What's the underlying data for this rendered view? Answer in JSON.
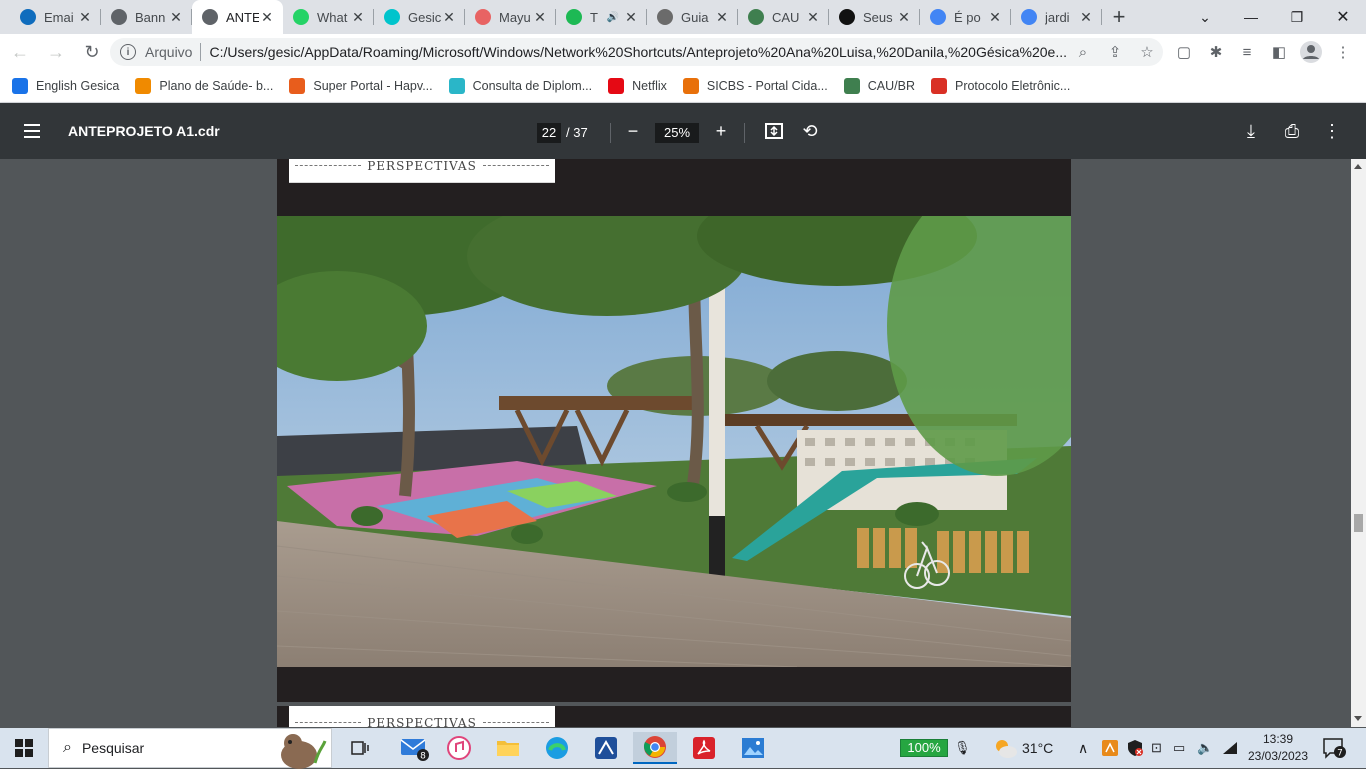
{
  "tabs": [
    {
      "title": "Emai",
      "icon": "outlook-icon",
      "color": "#0f6cbd",
      "active": false
    },
    {
      "title": "Bann",
      "icon": "globe-icon",
      "color": "#5f6368",
      "active": false
    },
    {
      "title": "ANTE",
      "icon": "globe-icon",
      "color": "#5f6368",
      "active": true
    },
    {
      "title": "What",
      "icon": "whatsapp-icon",
      "color": "#25d366",
      "active": false
    },
    {
      "title": "Gesic",
      "icon": "canva-icon",
      "color": "#00c4cc",
      "active": false
    },
    {
      "title": "Mayu",
      "icon": "mayu-icon",
      "color": "#e86363",
      "active": false
    },
    {
      "title": "T",
      "icon": "spotify-icon",
      "color": "#1db954",
      "active": false,
      "audio": true
    },
    {
      "title": "Guia",
      "icon": "guia-icon",
      "color": "#6b6b6b",
      "active": false
    },
    {
      "title": "CAU",
      "icon": "cau-icon",
      "color": "#3f7f4f",
      "active": false
    },
    {
      "title": "Seus",
      "icon": "amazon-icon",
      "color": "#111111",
      "active": false
    },
    {
      "title": "É po",
      "icon": "google-icon",
      "color": "#4285f4",
      "active": false
    },
    {
      "title": "jardi",
      "icon": "google-icon",
      "color": "#4285f4",
      "active": false
    }
  ],
  "address": {
    "scheme": "Arquivo",
    "url": "C:/Users/gesic/AppData/Roaming/Microsoft/Windows/Network%20Shortcuts/Anteprojeto%20Ana%20Luisa,%20Danila,%20Gésica%20e..."
  },
  "bookmarks": [
    {
      "label": "English Gesica",
      "icon": "contact-icon",
      "color": "#1a73e8"
    },
    {
      "label": "Plano de Saúde- b...",
      "icon": "hapvida-icon",
      "color": "#f08a00"
    },
    {
      "label": "Super Portal - Hapv...",
      "icon": "hapvida-icon",
      "color": "#e85d1c"
    },
    {
      "label": "Consulta de Diplom...",
      "icon": "diploma-icon",
      "color": "#2ab6c8"
    },
    {
      "label": "Netflix",
      "icon": "netflix-icon",
      "color": "#e50914"
    },
    {
      "label": "SICBS - Portal Cida...",
      "icon": "sicbs-icon",
      "color": "#e8700a"
    },
    {
      "label": "CAU/BR",
      "icon": "cau-icon",
      "color": "#3f7f4f"
    },
    {
      "label": "Protocolo Eletrônic...",
      "icon": "protocol-icon",
      "color": "#d93025"
    }
  ],
  "pdf": {
    "filename": "ANTEPROJETO A1.cdr",
    "page_current": "22",
    "page_total": "/ 37",
    "zoom": "25%",
    "section_label": "PERSPECTIVAS"
  },
  "taskbar": {
    "search_placeholder": "Pesquisar",
    "mail_badge": "8",
    "battery": "100%",
    "temperature": "31°C",
    "time": "13:39",
    "date": "23/03/2023",
    "notifications": "7"
  }
}
